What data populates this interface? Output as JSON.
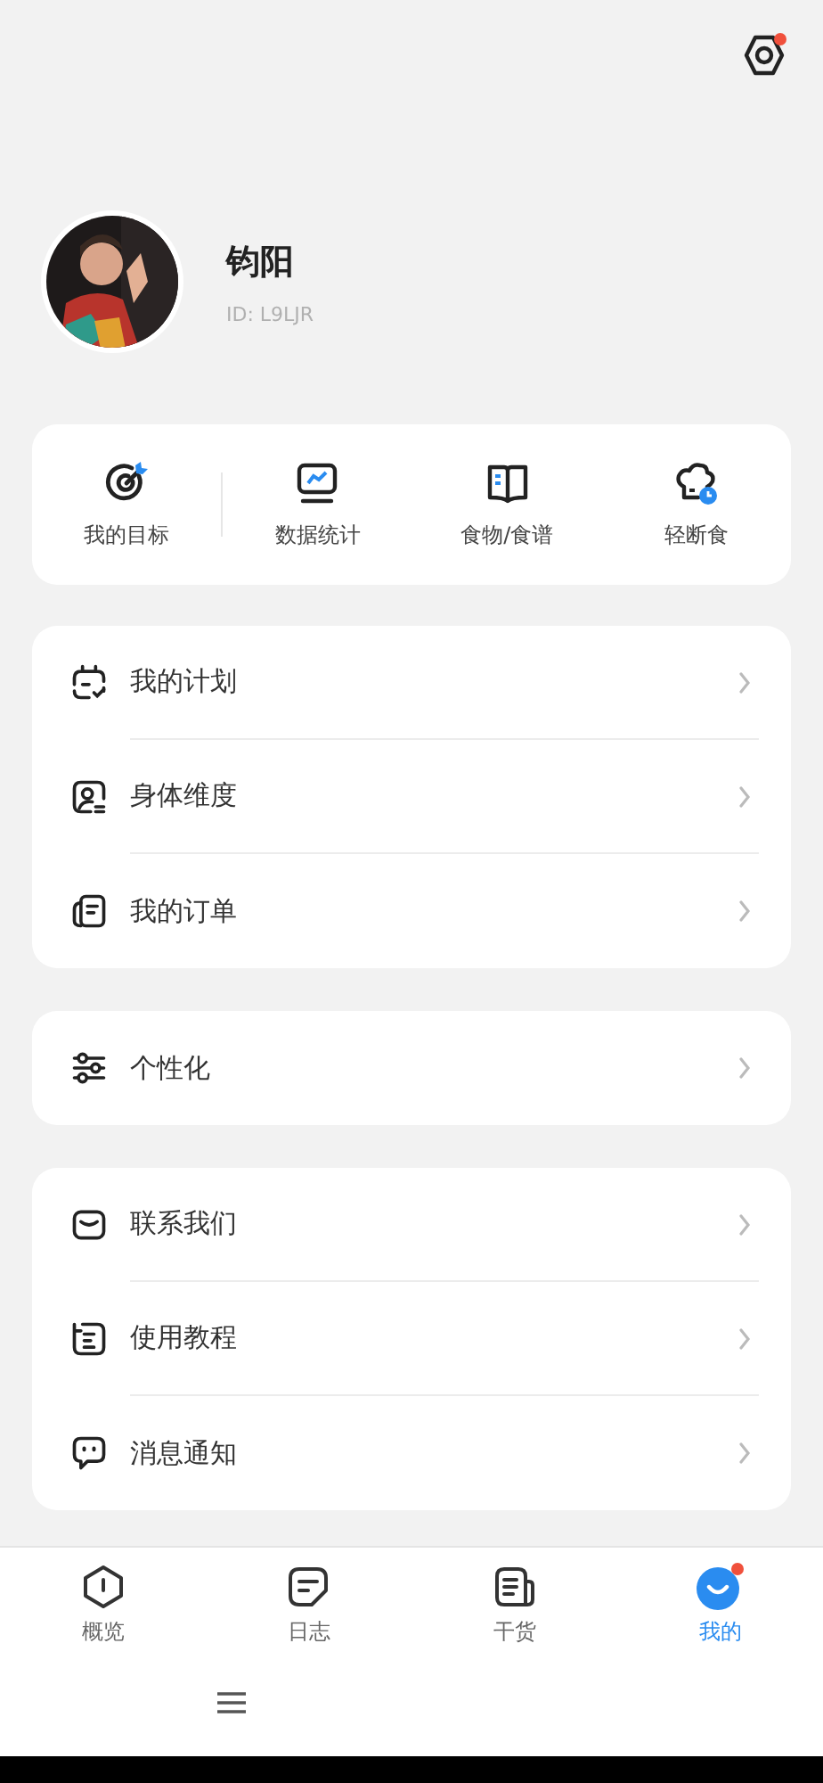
{
  "settings": {
    "has_dot": true
  },
  "profile": {
    "name": "钧阳",
    "id": "ID: L9LJR"
  },
  "shortcuts": [
    {
      "label": "我的目标"
    },
    {
      "label": "数据统计"
    },
    {
      "label": "食物/食谱"
    },
    {
      "label": "轻断食"
    }
  ],
  "menu_groups": [
    [
      {
        "label": "我的计划"
      },
      {
        "label": "身体维度"
      },
      {
        "label": "我的订单"
      }
    ],
    [
      {
        "label": "个性化"
      }
    ],
    [
      {
        "label": "联系我们"
      },
      {
        "label": "使用教程"
      },
      {
        "label": "消息通知"
      }
    ]
  ],
  "tabs": [
    {
      "label": "概览",
      "selected": false,
      "has_dot": false
    },
    {
      "label": "日志",
      "selected": false,
      "has_dot": false
    },
    {
      "label": "干货",
      "selected": false,
      "has_dot": false
    },
    {
      "label": "我的",
      "selected": true,
      "has_dot": true
    }
  ]
}
